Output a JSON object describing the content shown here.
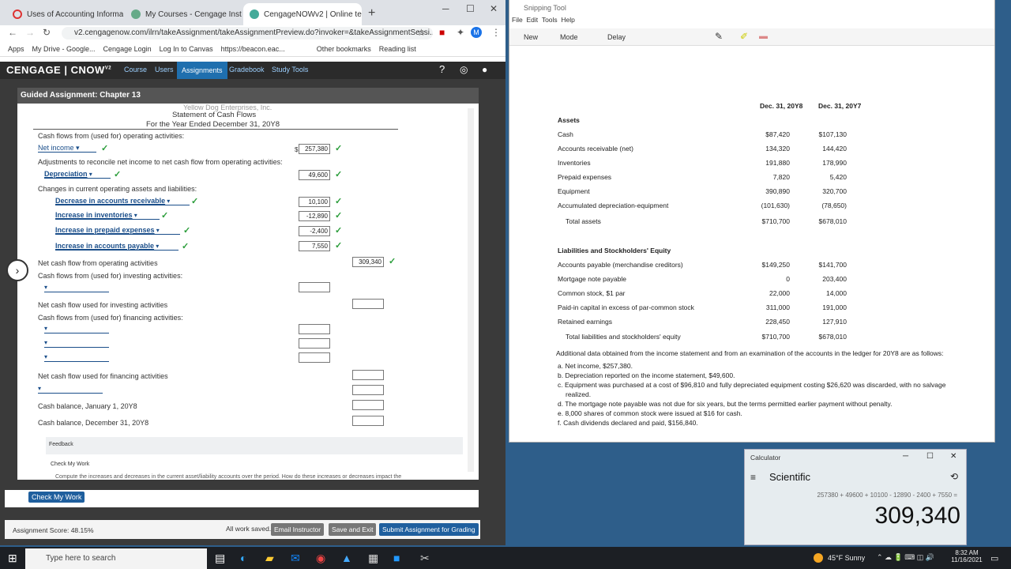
{
  "browser": {
    "tabs": [
      "Uses of Accounting Informatic",
      "My Courses - Cengage Instruc",
      "CengageNOWv2 | Online teac"
    ],
    "url": "v2.cengagenow.com/ilrn/takeAssignment/takeAssignmentPreview.do?invoker=&takeAssignmentSessi...",
    "bookmarks": [
      "Apps",
      "My Drive - Google...",
      "Cengage Login",
      "Log In to Canvas",
      "https://beacon.eac...",
      "Other bookmarks",
      "Reading list"
    ]
  },
  "cengage": {
    "logo": "CENGAGE | CNOW",
    "logo_sup": "V2",
    "nav": [
      "Course",
      "Users",
      "Assignments",
      "Gradebook",
      "Study Tools"
    ],
    "guided_title": "Guided Assignment: Chapter 13",
    "statement": {
      "company": "Yellow Dog Enterprises, Inc.",
      "title": "Statement of Cash Flows",
      "period": "For the Year Ended December 31, 20Y8"
    },
    "op_heading": "Cash flows from (used for) operating activities:",
    "net_income_label": "Net income",
    "net_income_value": "257,380",
    "dollar": "$",
    "adj_heading": "Adjustments to reconcile net income to net cash flow from operating activities:",
    "dep_label": "Depreciation",
    "dep_value": "49,600",
    "changes_heading": "Changes in current operating assets and liabilities:",
    "items": [
      {
        "label": "Decrease in accounts receivable",
        "value": "10,100"
      },
      {
        "label": "Increase in inventories",
        "value": "-12,890"
      },
      {
        "label": "Increase in prepaid expenses",
        "value": "-2,400"
      },
      {
        "label": "Increase in accounts payable",
        "value": "7,550"
      }
    ],
    "net_op_label": "Net cash flow from operating activities",
    "net_op_value": "309,340",
    "inv_heading": "Cash flows from (used for) investing activities:",
    "net_inv_label": "Net cash flow used for investing activities",
    "fin_heading": "Cash flows from (used for) financing activities:",
    "net_fin_label": "Net cash flow used for financing activities",
    "cash_jan": "Cash balance, January 1, 20Y8",
    "cash_dec": "Cash balance, December 31, 20Y8",
    "feedback": "Feedback",
    "check_my_work_fb": "Check My Work",
    "fb_text": "Compute the increases and decreases in the current asset/liability accounts over the period. How do these increases or decreases impact the",
    "check_btn": "Check My Work",
    "score": "Assignment Score: 48.15%",
    "saved": "All work saved.",
    "buttons": [
      "Email Instructor",
      "Save and Exit",
      "Submit Assignment for Grading"
    ]
  },
  "snip": {
    "title": "Snipping Tool",
    "menu": [
      "File",
      "Edit",
      "Tools",
      "Help"
    ],
    "toolbar": [
      "New",
      "Mode",
      "Delay"
    ]
  },
  "balance": {
    "col1": "Dec. 31, 20Y8",
    "col2": "Dec. 31, 20Y7",
    "assets": "Assets",
    "rows": [
      [
        "Cash",
        "$87,420",
        "$107,130"
      ],
      [
        "Accounts receivable (net)",
        "134,320",
        "144,420"
      ],
      [
        "Inventories",
        "191,880",
        "178,990"
      ],
      [
        "Prepaid expenses",
        "7,820",
        "5,420"
      ],
      [
        "Equipment",
        "390,890",
        "320,700"
      ],
      [
        "Accumulated depreciation-equipment",
        "(101,630)",
        "(78,650)"
      ],
      [
        "Total assets",
        "$710,700",
        "$678,010"
      ]
    ],
    "liab_heading": "Liabilities and Stockholders' Equity",
    "rows2": [
      [
        "Accounts payable (merchandise creditors)",
        "$149,250",
        "$141,700"
      ],
      [
        "Mortgage note payable",
        "0",
        "203,400"
      ],
      [
        "Common stock, $1 par",
        "22,000",
        "14,000"
      ],
      [
        "Paid-in capital in excess of par-common stock",
        "311,000",
        "191,000"
      ],
      [
        "Retained earnings",
        "228,450",
        "127,910"
      ],
      [
        "Total liabilities and stockholders' equity",
        "$710,700",
        "$678,010"
      ]
    ],
    "additional": "Additional data obtained from the income statement and from an examination of the accounts in the ledger for 20Y8 are as follows:",
    "notes": [
      "a. Net income, $257,380.",
      "b. Depreciation reported on the income statement, $49,600.",
      "c. Equipment was purchased at a cost of $96,810 and fully depreciated equipment costing $26,620 was discarded, with no salvage",
      "realized.",
      "d. The mortgage note payable was not due for six years, but the terms permitted earlier payment without penalty.",
      "e. 8,000 shares of common stock were issued at $16 for cash.",
      "f. Cash dividends declared and paid, $156,840."
    ]
  },
  "calc": {
    "title": "Calculator",
    "mode": "Scientific",
    "expr": "257380 + 49600 + 10100 - 12890 - 2400 + 7550 =",
    "result": "309,340"
  },
  "taskbar": {
    "search": "Type here to search",
    "weather": "45°F  Sunny",
    "time": "8:32 AM",
    "date": "11/16/2021"
  }
}
